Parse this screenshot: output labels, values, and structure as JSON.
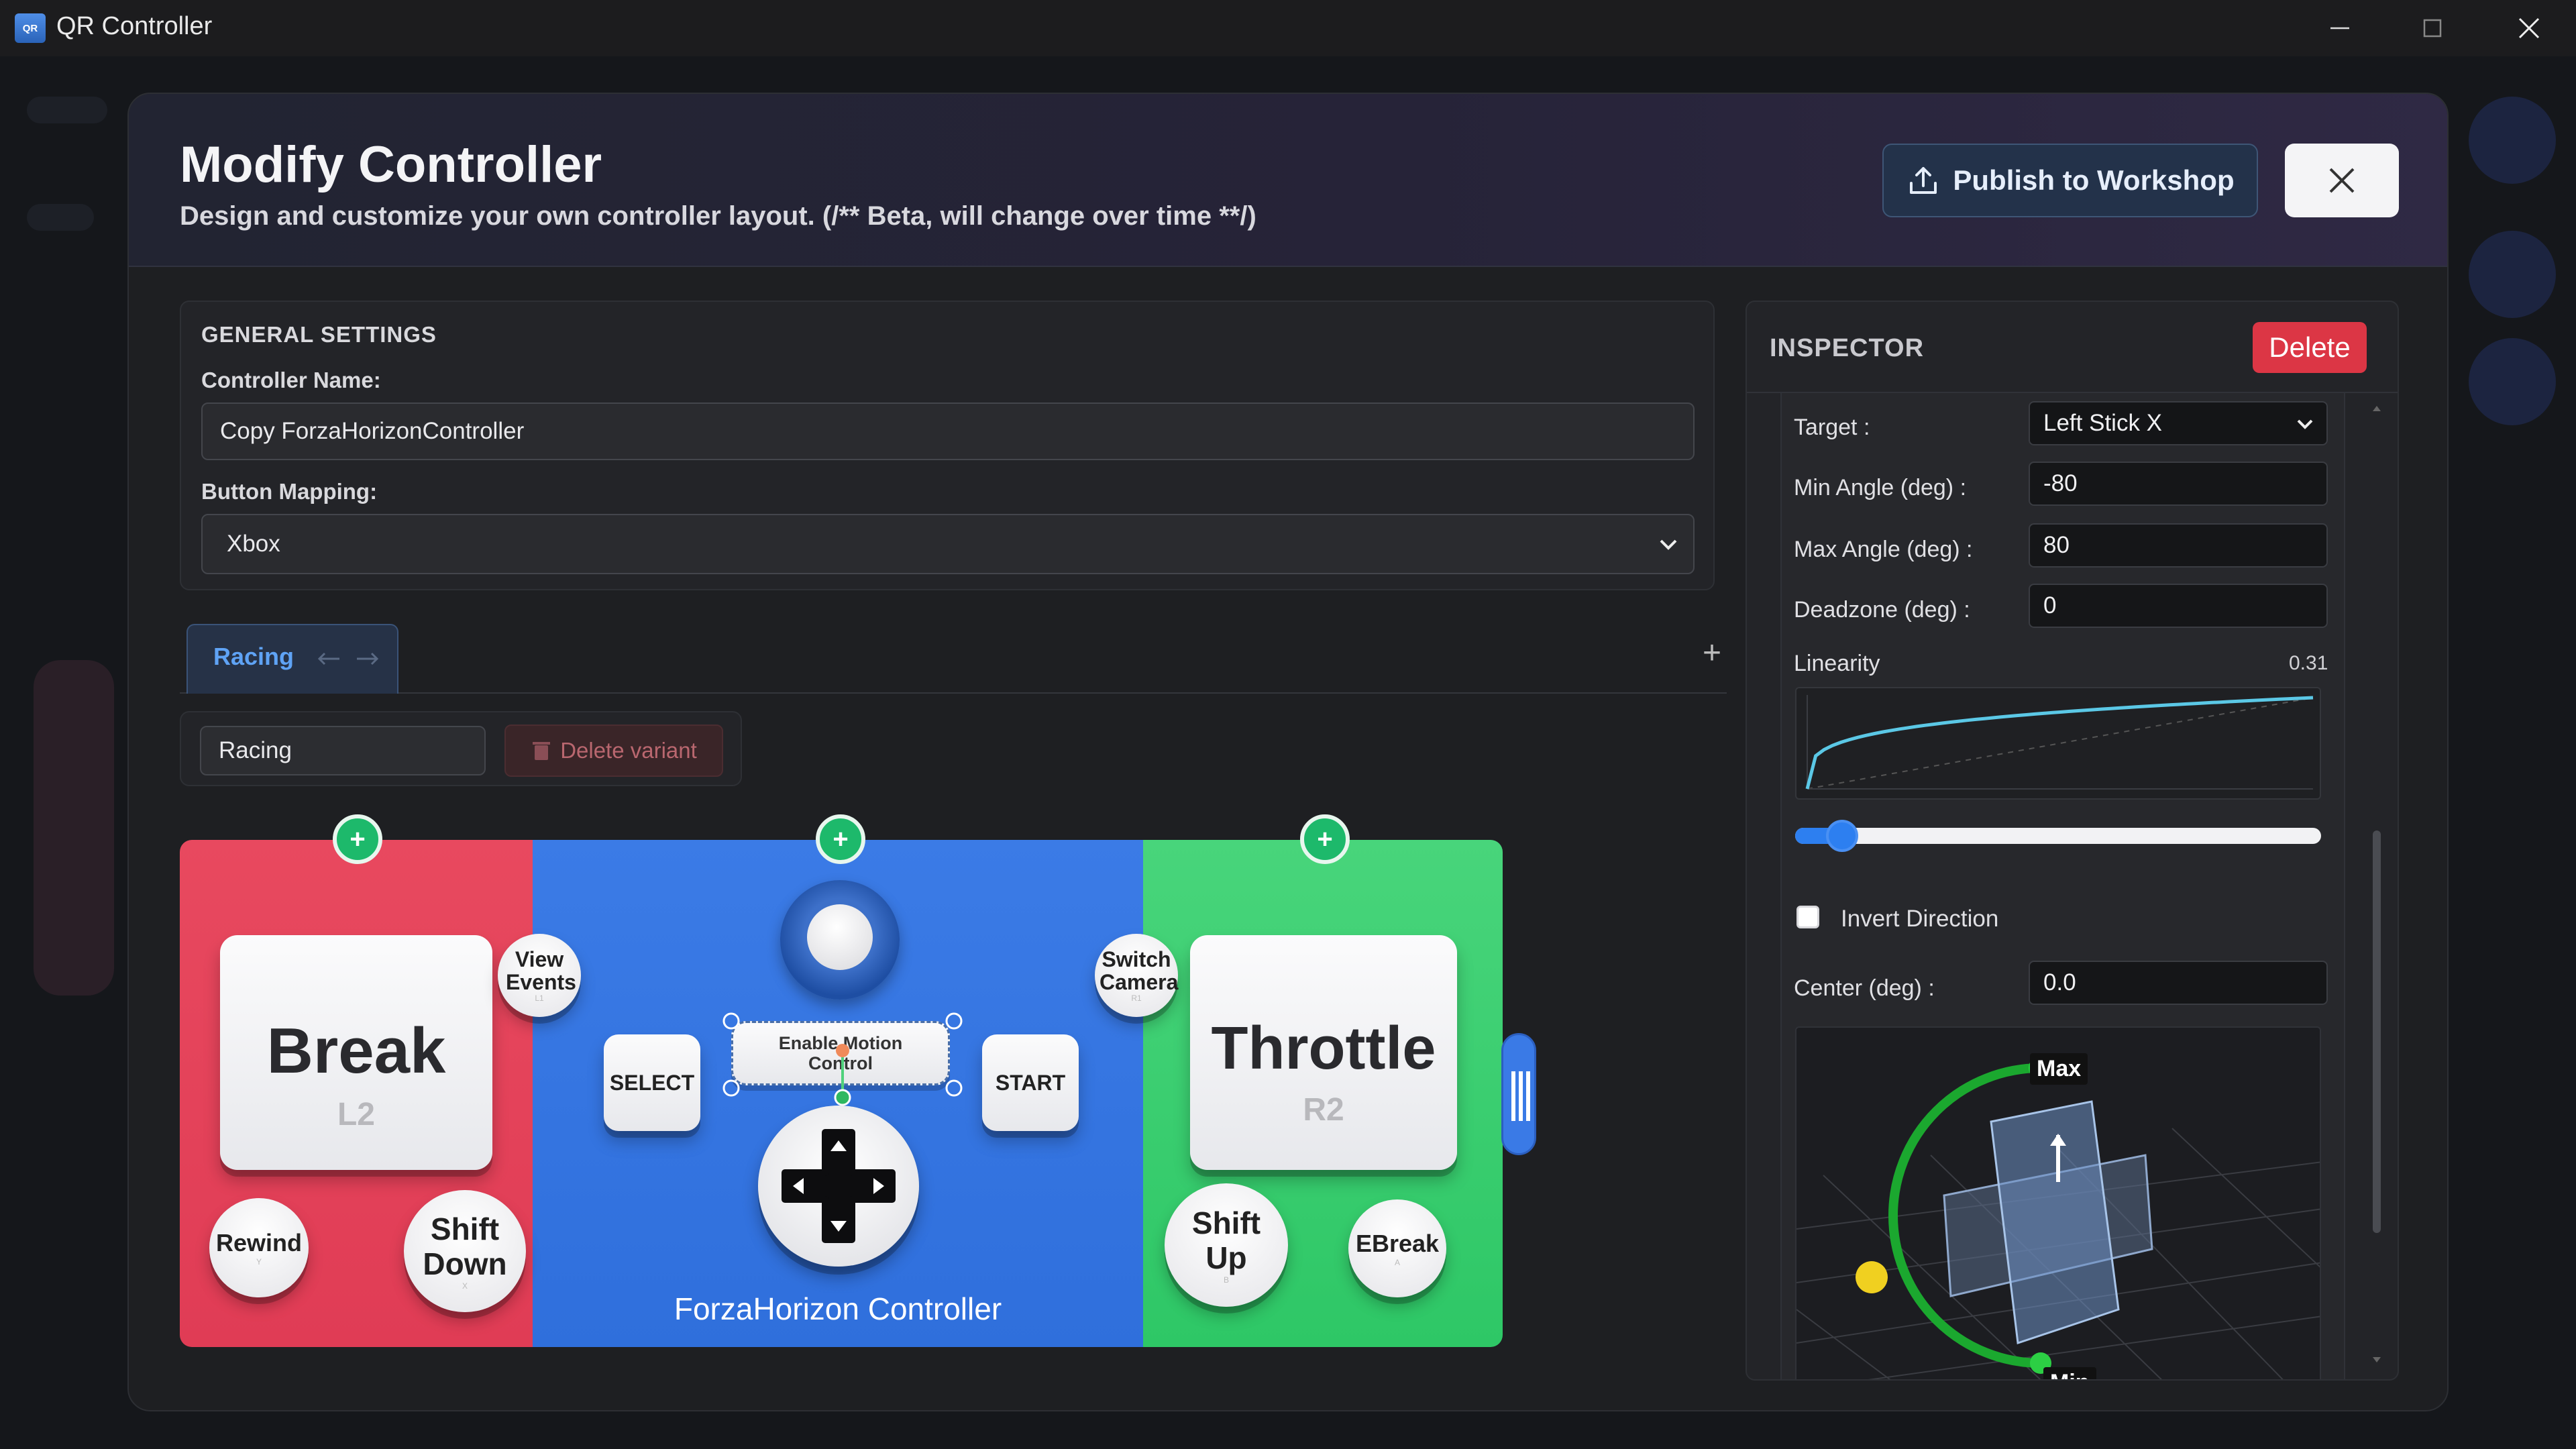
{
  "window": {
    "app_icon_text": "QR",
    "title": "QR Controller"
  },
  "modal": {
    "title": "Modify Controller",
    "subtitle": "Design and customize your own controller layout. (/** Beta, will change over time **/)",
    "publish_label": "Publish to Workshop"
  },
  "general": {
    "heading": "GENERAL SETTINGS",
    "name_label": "Controller Name:",
    "name_value": "Copy ForzaHorizonController",
    "mapping_label": "Button Mapping:",
    "mapping_value": "Xbox"
  },
  "tabs": {
    "items": [
      {
        "label": "Racing"
      }
    ],
    "add_label": "+"
  },
  "variant": {
    "name_value": "Racing",
    "delete_label": "Delete variant"
  },
  "controller": {
    "name": "ForzaHorizon Controller",
    "left": {
      "break_label": "Break",
      "break_sub": "L2",
      "view_label": "View Events",
      "view_sub": "L1",
      "rewind_label": "Rewind",
      "rewind_sub": "Y",
      "shiftdown_label": "Shift Down",
      "shiftdown_sub": "X"
    },
    "center": {
      "select_label": "SELECT",
      "start_label": "START",
      "motion_label": "Enable Motion Control"
    },
    "right": {
      "switch_label": "Switch Camera",
      "switch_sub": "R1",
      "throttle_label": "Throttle",
      "throttle_sub": "R2",
      "shiftup_label": "Shift Up",
      "shiftup_sub": "B",
      "ebreak_label": "EBreak",
      "ebreak_sub": "A"
    },
    "colors": {
      "left": "#e8495f",
      "center": "#3b7be6",
      "right": "#2ec766"
    }
  },
  "inspector": {
    "heading": "INSPECTOR",
    "delete_label": "Delete",
    "target_label": "Target :",
    "target_value": "Left Stick X",
    "min_label": "Min Angle (deg) :",
    "min_value": "-80",
    "max_label": "Max Angle (deg) :",
    "max_value": "80",
    "deadzone_label": "Deadzone (deg) :",
    "deadzone_value": "0",
    "linearity_label": "Linearity",
    "linearity_value": "0.31",
    "linearity_fraction": 0.31,
    "invert_label": "Invert Direction",
    "invert_checked": false,
    "center_label": "Center (deg) :",
    "center_value": "0.0",
    "viz_max_label": "Max",
    "viz_min_label": "Min"
  }
}
